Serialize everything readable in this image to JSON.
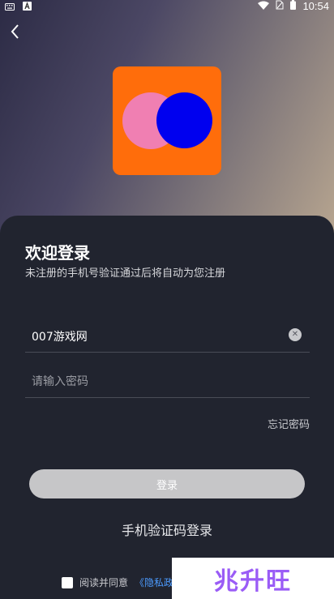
{
  "status_bar": {
    "time": "10:54",
    "icons": [
      "keyboard-icon",
      "a-icon",
      "wifi-icon",
      "sim-icon",
      "battery-icon"
    ]
  },
  "header": {
    "back_icon": "chevron-left-icon"
  },
  "colors": {
    "logo_bg": "#ff6d0b",
    "logo_pink": "#f07fb2",
    "logo_blue": "#0000ef",
    "panel_bg": "#21242f",
    "button_bg": "#c6c6c8",
    "link": "#4c9bff"
  },
  "login": {
    "title": "欢迎登录",
    "subtitle": "未注册的手机号验证通过后将自动为您注册",
    "account_value": "007游戏网",
    "password_placeholder": "请输入密码",
    "forgot_label": "忘记密码",
    "login_button": "登录",
    "sms_login_label": "手机验证码登录",
    "agree_text": "阅读并同意",
    "agree_link": "《隐私政"
  },
  "watermark": {
    "text": "兆升旺"
  }
}
